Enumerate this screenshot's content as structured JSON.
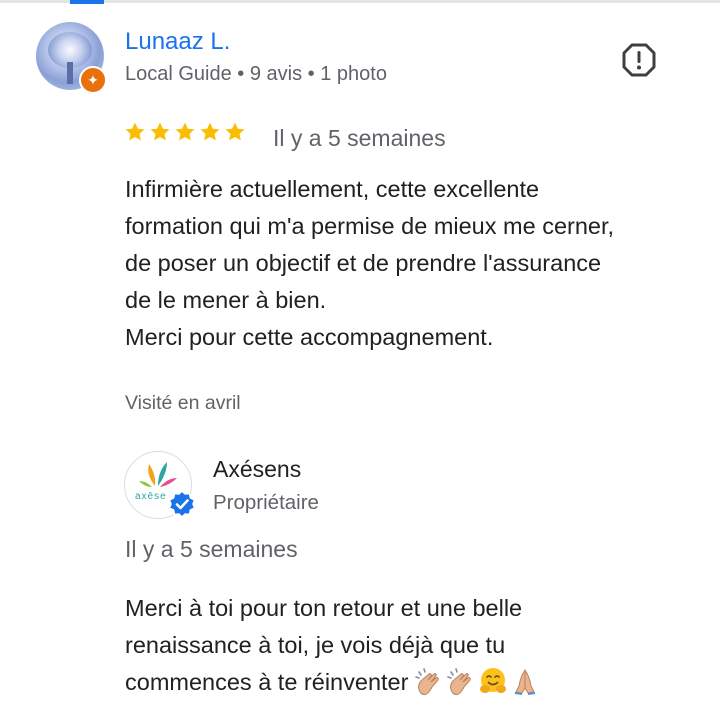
{
  "review": {
    "reviewer_name": "Lunaaz L.",
    "reviewer_meta": "Local Guide • 9 avis • 1 photo",
    "rating": 5,
    "time_ago": "Il y a 5 semaines",
    "text": "Infirmière actuellement, cette excellente\nformation qui m'a permise de mieux me cerner,\nde poser un objectif et de prendre l'assurance\nde le mener à bien.\nMerci pour cette accompagnement.",
    "visited": "Visité en avril"
  },
  "owner_response": {
    "owner_name": "Axésens",
    "owner_role": "Propriétaire",
    "logo_word": "axēse",
    "time_ago": "Il y a 5 semaines",
    "text": "Merci à toi pour ton retour et une belle\nrenaissance à toi, je vois déjà que tu\ncommences à te réinventer",
    "emojis": [
      "clapping-hands-emoji",
      "clapping-hands-emoji",
      "hugging-face-emoji",
      "folded-hands-emoji"
    ]
  },
  "colors": {
    "link_blue": "#1a73e8",
    "star_gold": "#fbbc04",
    "guide_orange": "#e8710a",
    "secondary_text": "#5f6368"
  }
}
